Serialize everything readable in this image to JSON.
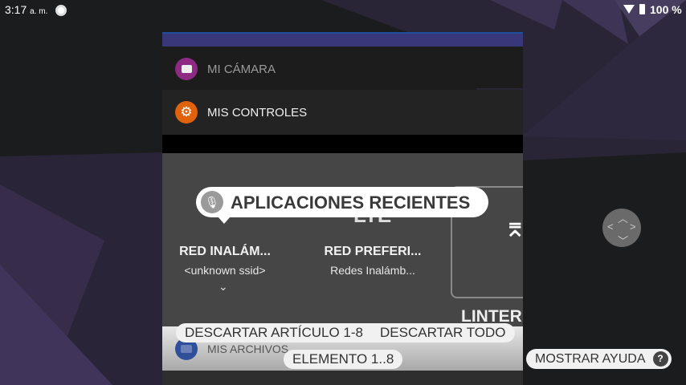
{
  "status_bar": {
    "time": "3:17",
    "ampm": "a. m.",
    "battery": "100 %"
  },
  "cards": [
    {
      "label": "MI CÁMARA",
      "icon": "camera-icon",
      "color": "#8e2a84"
    },
    {
      "label": "MIS CONTROLES",
      "icon": "gear-icon",
      "color": "#e0620c"
    },
    {
      "label": "MIS ARCHIVOS",
      "icon": "folder-icon",
      "color": "#2f4f9a"
    }
  ],
  "quick_settings": [
    {
      "title": "RED INALÁM...",
      "subtitle": "<unknown ssid>"
    },
    {
      "title": "RED PREFERI...",
      "subtitle": "Redes Inalámb...",
      "badge": "LTE"
    },
    {
      "title": "LINTER"
    }
  ],
  "tooltip": {
    "text": "APLICACIONES RECIENTES",
    "icon": "microphone-icon"
  },
  "chips": {
    "dismiss_item": "DESCARTAR ARTÍCULO 1-8",
    "dismiss_all": "DESCARTAR TODO",
    "element": "ELEMENTO 1..8",
    "show_help": "MOSTRAR AYUDA",
    "help_icon": "?"
  }
}
